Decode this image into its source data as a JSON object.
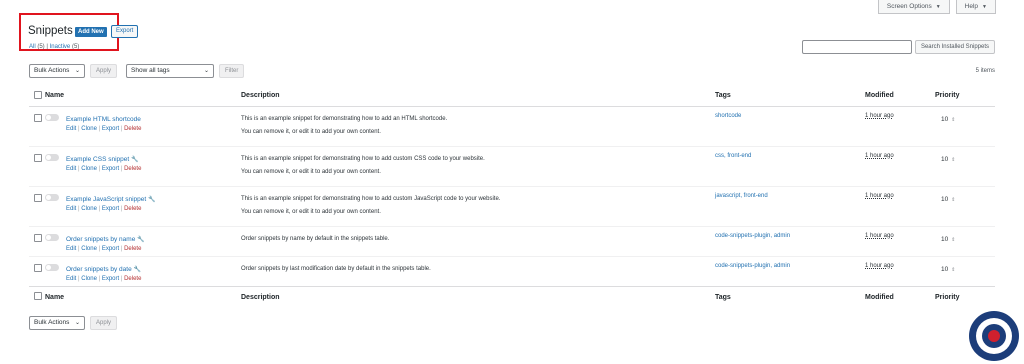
{
  "screen_meta": {
    "screen_options": "Screen Options",
    "help": "Help"
  },
  "header": {
    "title": "Snippets",
    "add_new": "Add New",
    "export": "Export",
    "views": {
      "all": "All",
      "all_count": "(5)",
      "sep": "|",
      "inactive": "Inactive",
      "inactive_count": "(5)"
    }
  },
  "search": {
    "placeholder": "",
    "button": "Search Installed Snippets"
  },
  "tablenav_top": {
    "bulk_actions": "Bulk Actions",
    "apply": "Apply",
    "tags_filter": "Show all tags",
    "filter": "Filter",
    "items_count": "5 items"
  },
  "columns": {
    "name": "Name",
    "description": "Description",
    "tags": "Tags",
    "modified": "Modified",
    "priority": "Priority"
  },
  "row_actions": {
    "edit": "Edit",
    "clone": "Clone",
    "export": "Export",
    "delete": "Delete",
    "sep": "|"
  },
  "rows": [
    {
      "name": "Example HTML shortcode",
      "desc1": "This is an example snippet for demonstrating how to add an HTML shortcode.",
      "desc2": "You can remove it, or edit it to add your own content.",
      "tags": "shortcode",
      "modified": "1 hour ago",
      "priority": "10"
    },
    {
      "name": "Example CSS snippet",
      "desc1": "This is an example snippet for demonstrating how to add custom CSS code to your website.",
      "desc2": "You can remove it, or edit it to add your own content.",
      "tags": "css, front-end",
      "modified": "1 hour ago",
      "priority": "10"
    },
    {
      "name": "Example JavaScript snippet",
      "desc1": "This is an example snippet for demonstrating how to add custom JavaScript code to your website.",
      "desc2": "You can remove it, or edit it to add your own content.",
      "tags": "javascript, front-end",
      "modified": "1 hour ago",
      "priority": "10"
    },
    {
      "name": "Order snippets by name",
      "desc1": "Order snippets by name by default in the snippets table.",
      "desc2": "",
      "tags": "code-snippets-plugin, admin",
      "modified": "1 hour ago",
      "priority": "10"
    },
    {
      "name": "Order snippets by date",
      "desc1": "Order snippets by last modification date by default in the snippets table.",
      "desc2": "",
      "tags": "code-snippets-plugin, admin",
      "modified": "1 hour ago",
      "priority": "10"
    }
  ],
  "tablenav_bottom": {
    "bulk_actions": "Bulk Actions",
    "apply": "Apply"
  },
  "icons": {
    "wrench": "wrench-icon",
    "caret": "caret-down-icon",
    "spinner": "spinner-arrows-icon"
  },
  "colors": {
    "link": "#2271b1",
    "delete": "#b32d2e",
    "highlight": "#e0141e",
    "badge_blue": "#1c3d7a",
    "badge_red": "#d0202e"
  }
}
